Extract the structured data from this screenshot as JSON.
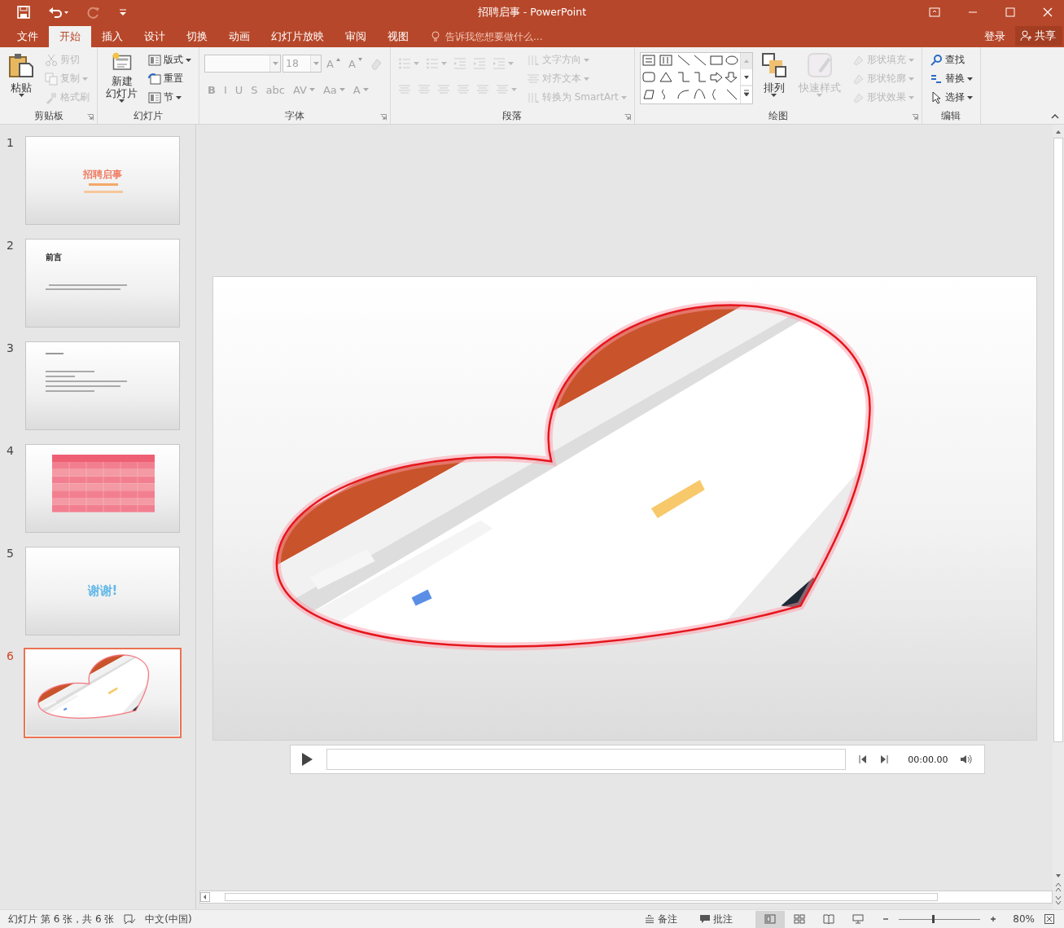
{
  "window": {
    "title": "招聘启事 - PowerPoint"
  },
  "menu_tabs": [
    {
      "label": "文件",
      "selected": false
    },
    {
      "label": "开始",
      "selected": true
    },
    {
      "label": "插入",
      "selected": false
    },
    {
      "label": "设计",
      "selected": false
    },
    {
      "label": "切换",
      "selected": false
    },
    {
      "label": "动画",
      "selected": false
    },
    {
      "label": "幻灯片放映",
      "selected": false
    },
    {
      "label": "审阅",
      "selected": false
    },
    {
      "label": "视图",
      "selected": false
    }
  ],
  "tell_me": {
    "placeholder": "告诉我您想要做什么..."
  },
  "account": {
    "sign_in": "登录",
    "share": "共享"
  },
  "ribbon": {
    "groups": [
      {
        "label": "剪贴板",
        "launcher": true,
        "columns": [
          [
            {
              "kind": "large",
              "lines": [
                "粘贴"
              ],
              "dropdown": true,
              "disabled": false
            }
          ],
          [
            {
              "kind": "small",
              "label": "剪切",
              "dropdown": false,
              "disabled": true
            },
            {
              "kind": "small",
              "label": "复制",
              "dropdown": true,
              "disabled": true
            },
            {
              "kind": "small",
              "label": "格式刷",
              "dropdown": false,
              "disabled": true
            }
          ]
        ]
      },
      {
        "label": "幻灯片",
        "launcher": false,
        "columns": [
          [
            {
              "kind": "large",
              "lines": [
                "新建",
                "幻灯片"
              ],
              "dropdown": true,
              "disabled": false
            }
          ],
          [
            {
              "kind": "small",
              "label": "版式",
              "dropdown": true,
              "disabled": false
            },
            {
              "kind": "small",
              "label": "重置",
              "dropdown": false,
              "disabled": false
            },
            {
              "kind": "small",
              "label": "节",
              "dropdown": true,
              "disabled": false
            }
          ]
        ]
      },
      {
        "label": "字体",
        "launcher": true,
        "columns": [
          [
            {
              "kind": "row",
              "items": [
                {
                  "kind": "font-field",
                  "dropdown": true,
                  "disabled": true
                },
                {
                  "kind": "size-field",
                  "value": "18",
                  "dropdown": true,
                  "disabled": true
                },
                {
                  "kind": "grow",
                  "label": "A",
                  "dropdown": false,
                  "disabled": true
                },
                {
                  "kind": "shrink",
                  "label": "A",
                  "dropdown": false,
                  "disabled": true
                },
                {
                  "kind": "icon",
                  "dropdown": false,
                  "disabled": true
                }
              ]
            },
            {
              "kind": "row",
              "items": [
                {
                  "kind": "glyph",
                  "label": "B",
                  "dropdown": false,
                  "disabled": true
                },
                {
                  "kind": "glyph",
                  "label": "I",
                  "dropdown": false,
                  "disabled": true
                },
                {
                  "kind": "glyph",
                  "label": "U",
                  "dropdown": false,
                  "disabled": true
                },
                {
                  "kind": "glyph",
                  "label": "S",
                  "dropdown": false,
                  "disabled": true
                },
                {
                  "kind": "glyph",
                  "label": "abc",
                  "dropdown": false,
                  "disabled": true
                },
                {
                  "kind": "glyph",
                  "label": "AV",
                  "dropdown": true,
                  "disabled": true
                },
                {
                  "kind": "glyph",
                  "label": "Aa",
                  "dropdown": true,
                  "disabled": true
                },
                {
                  "kind": "glyph",
                  "label": "A",
                  "dropdown": true,
                  "disabled": true
                }
              ]
            }
          ]
        ]
      },
      {
        "label": "段落",
        "launcher": true,
        "columns": [
          [
            {
              "kind": "row",
              "items": [
                {
                  "kind": "icon",
                  "dropdown": true,
                  "disabled": true
                },
                {
                  "kind": "icon",
                  "dropdown": true,
                  "disabled": true
                },
                {
                  "kind": "icon",
                  "dropdown": false,
                  "disabled": true
                },
                {
                  "kind": "icon",
                  "dropdown": false,
                  "disabled": true
                },
                {
                  "kind": "icon",
                  "dropdown": true,
                  "disabled": true
                }
              ]
            },
            {
              "kind": "row",
              "items": [
                {
                  "kind": "icon",
                  "dropdown": false,
                  "disabled": true
                },
                {
                  "kind": "icon",
                  "dropdown": false,
                  "disabled": true
                },
                {
                  "kind": "icon",
                  "dropdown": false,
                  "disabled": true
                },
                {
                  "kind": "icon",
                  "dropdown": false,
                  "disabled": true
                },
                {
                  "kind": "icon",
                  "dropdown": false,
                  "disabled": true
                },
                {
                  "kind": "icon",
                  "dropdown": true,
                  "disabled": true
                }
              ]
            }
          ],
          [
            {
              "kind": "small",
              "label": "文字方向",
              "dropdown": true,
              "disabled": true
            },
            {
              "kind": "small",
              "label": "对齐文本",
              "dropdown": true,
              "disabled": true
            },
            {
              "kind": "small",
              "label": "转换为 SmartArt",
              "dropdown": true,
              "disabled": true
            }
          ]
        ]
      },
      {
        "label": "绘图",
        "launcher": true,
        "columns": [
          [
            {
              "kind": "gallery"
            }
          ],
          [
            {
              "kind": "large",
              "lines": [
                "排列"
              ],
              "dropdown": true,
              "disabled": false
            }
          ],
          [
            {
              "kind": "large",
              "lines": [
                "快速样式"
              ],
              "dropdown": true,
              "disabled": true
            }
          ],
          [
            {
              "kind": "small",
              "label": "形状填充",
              "dropdown": true,
              "disabled": true
            },
            {
              "kind": "small",
              "label": "形状轮廓",
              "dropdown": true,
              "disabled": true
            },
            {
              "kind": "small",
              "label": "形状效果",
              "dropdown": true,
              "disabled": true
            }
          ]
        ]
      },
      {
        "label": "编辑",
        "launcher": false,
        "columns": [
          [
            {
              "kind": "small",
              "label": "查找",
              "dropdown": false,
              "disabled": false
            },
            {
              "kind": "small",
              "label": "替换",
              "dropdown": true,
              "disabled": false
            },
            {
              "kind": "small",
              "label": "选择",
              "dropdown": true,
              "disabled": false
            }
          ]
        ]
      }
    ]
  },
  "slides": [
    {
      "number": "1",
      "kind": "title",
      "title": "招聘启事",
      "selected": false
    },
    {
      "number": "2",
      "kind": "heading",
      "title": "前言",
      "selected": false
    },
    {
      "number": "3",
      "kind": "text",
      "selected": false
    },
    {
      "number": "4",
      "kind": "table",
      "selected": false
    },
    {
      "number": "5",
      "kind": "thanks",
      "title": "谢谢!",
      "selected": false
    },
    {
      "number": "6",
      "kind": "picture",
      "selected": true
    }
  ],
  "media_player": {
    "level": 0,
    "time": "00:00.00"
  },
  "status_bar": {
    "slide_info": "幻灯片 第 6 张，共 6 张",
    "language": "中文(中国)",
    "notes": "备注",
    "comments": "批注",
    "views": [
      {
        "selected": true
      },
      {
        "selected": false
      },
      {
        "selected": false
      },
      {
        "selected": false
      }
    ],
    "zoom": {
      "level": 0.41,
      "value": "80%"
    }
  }
}
